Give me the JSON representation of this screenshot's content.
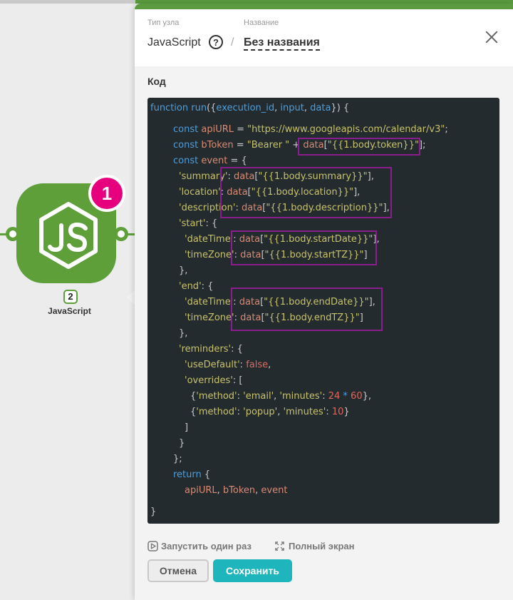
{
  "node": {
    "badge_number": "1",
    "order_number": "2",
    "label": "JavaScript",
    "logo_icon": "nodejs-icon"
  },
  "panel": {
    "type_label": "Тип узла",
    "type_value": "JavaScript",
    "name_label": "Название",
    "name_value": "Без названия",
    "section_title": "Код"
  },
  "code": {
    "lines": [
      "function run({execution_id, input, data}) {",
      "const apiURL = \"https://www.googleapis.com/calendar/v3\";",
      "const bToken = \"Bearer \" + data[\"{{1.body.token}}\"];",
      "const event = {",
      "'summary': data[\"{{1.body.summary}}\"],",
      "'location': data[\"{{1.body.location}}\"],",
      "'description': data[\"{{1.body.description}}\"],",
      "'start': {",
      "'dateTime': data[\"{{1.body.startDate}}\"],",
      "'timeZone': data[\"{{1.body.startTZ}}\"]",
      "},",
      "'end': {",
      "'dateTime': data[\"{{1.body.endDate}}\"],",
      "'timeZone': data[\"{{1.body.endTZ}}\"]",
      "},",
      "'reminders': {",
      "'useDefault': false,",
      "'overrides': [",
      "{'method': 'email', 'minutes': 24 * 60},",
      "{'method': 'popup', 'minutes': 10}",
      "]",
      "}",
      "};",
      "return {",
      "apiURL, bToken, event",
      "}"
    ]
  },
  "footer": {
    "run_once_label": "Запустить один раз",
    "fullscreen_label": "Полный экран",
    "cancel_label": "Отмена",
    "save_label": "Сохранить"
  },
  "colors": {
    "node_green": "#5e9f3a",
    "badge_pink": "#e6007e",
    "save_teal": "#1fb5bd",
    "highlight_purple": "#8a1e8f",
    "code_bg": "#232b2f"
  }
}
